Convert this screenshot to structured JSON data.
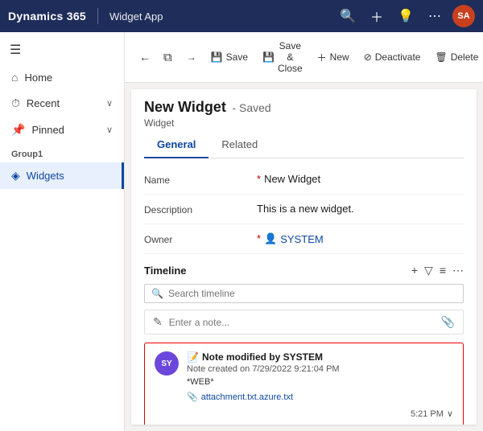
{
  "topNav": {
    "brand": "Dynamics 365",
    "divider": "|",
    "appName": "Widget App",
    "icons": [
      "search",
      "add",
      "lightbulb",
      "more"
    ],
    "avatar": "SA"
  },
  "sidebar": {
    "hamburgerIcon": "☰",
    "items": [
      {
        "label": "Home",
        "icon": "⌂",
        "active": false
      },
      {
        "label": "Recent",
        "icon": "⏱",
        "hasChevron": true,
        "active": false
      },
      {
        "label": "Pinned",
        "icon": "📌",
        "hasChevron": true,
        "active": false
      }
    ],
    "groupLabel": "Group1",
    "groupItems": [
      {
        "label": "Widgets",
        "icon": "◈",
        "active": true
      }
    ]
  },
  "commandBar": {
    "backIcon": "←",
    "saveIcon": "💾",
    "saveLabel": "Save",
    "saveCloseIcon": "💾",
    "saveCloseLabel": "Save & Close",
    "newIcon": "+",
    "newLabel": "New",
    "deactivateIcon": "⊘",
    "deactivateLabel": "Deactivate",
    "deleteIcon": "🗑",
    "deleteLabel": "Delete",
    "moreIcon": "⋯",
    "dupIcon": "⧉",
    "backArrowIcon": "←"
  },
  "page": {
    "title": "New Widget",
    "savedBadge": "- Saved",
    "subtitle": "Widget",
    "tabs": [
      {
        "label": "General",
        "active": true
      },
      {
        "label": "Related",
        "active": false
      }
    ]
  },
  "form": {
    "nameLabel": "Name",
    "nameRequired": "*",
    "nameValue": "New Widget",
    "descriptionLabel": "Description",
    "descriptionValue": "This is a new widget.",
    "ownerLabel": "Owner",
    "ownerRequired": "*",
    "ownerIcon": "👤",
    "ownerValue": "SYSTEM"
  },
  "timeline": {
    "title": "Timeline",
    "addIcon": "+",
    "filterIcon": "▽",
    "viewIcon": "≡",
    "moreIcon": "⋯",
    "searchPlaceholder": "Search timeline",
    "searchIcon": "🔍",
    "notePlaceholder": "Enter a note...",
    "pencilIcon": "✎",
    "clipIcon": "📎",
    "entry": {
      "avatarText": "SY",
      "noteIcon": "📝",
      "title": "Note modified by SYSTEM",
      "date": "Note created on 7/29/2022 9:21:04 PM",
      "text": "*WEB*",
      "attachment": "attachment.txt.azure.txt",
      "attachIcon": "📎",
      "time": "5:21 PM",
      "chevronIcon": "∨"
    }
  }
}
